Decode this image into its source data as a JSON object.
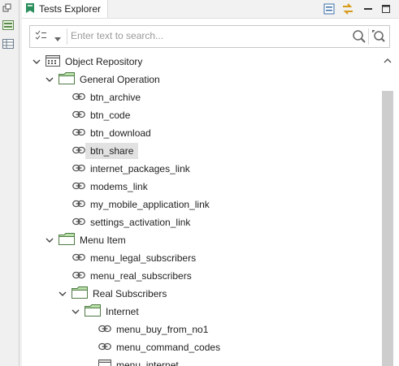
{
  "panel": {
    "title": "Tests Explorer"
  },
  "search": {
    "placeholder": "Enter text to search..."
  },
  "tree": {
    "root": "Object Repository",
    "general_operation": "General Operation",
    "general_items": [
      "btn_archive",
      "btn_code",
      "btn_download",
      "btn_share",
      "internet_packages_link",
      "modems_link",
      "my_mobile_application_link",
      "settings_activation_link"
    ],
    "menu_item": "Menu Item",
    "menu_items": [
      "menu_legal_subscribers",
      "menu_real_subscribers"
    ],
    "real_subscribers": "Real Subscribers",
    "internet": "Internet",
    "internet_items": [
      "menu_buy_from_no1",
      "menu_command_codes",
      "menu_internet"
    ]
  },
  "selected": "btn_share",
  "colors": {
    "folder_fill": "#b8e0a8",
    "folder_border": "#4f7a45",
    "selection": "#e2e2e2",
    "scroll_thumb": "#cdcdcd"
  }
}
